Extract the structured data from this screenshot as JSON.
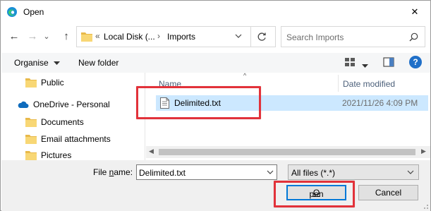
{
  "window": {
    "title": "Open",
    "close_glyph": "✕"
  },
  "nav": {
    "back_glyph": "←",
    "forward_glyph": "→",
    "recent_glyph": "⌄",
    "up_glyph": "↑"
  },
  "address": {
    "overflow": "«",
    "crumbs": [
      "Local Disk (...",
      "Imports"
    ],
    "separator": "›"
  },
  "search": {
    "placeholder": "Search Imports"
  },
  "toolbar": {
    "organise_label": "Organise",
    "new_folder_label": "New folder",
    "help_glyph": "?"
  },
  "nav_pane": {
    "items": [
      {
        "label": "Public",
        "icon": "folder-icon"
      },
      {
        "label": "OneDrive - Personal",
        "icon": "cloud-icon"
      },
      {
        "label": "Documents",
        "icon": "folder-icon"
      },
      {
        "label": "Email attachments",
        "icon": "folder-icon"
      },
      {
        "label": "Pictures",
        "icon": "folder-icon"
      }
    ]
  },
  "file_list": {
    "columns": [
      "Name",
      "Date modified"
    ],
    "sort_glyph": "^",
    "rows": [
      {
        "name": "Delimited.txt",
        "date": "2021/11/26 4:09 PM",
        "selected": true
      }
    ]
  },
  "scrollbar": {
    "left_glyph": "◀",
    "right_glyph": "▶"
  },
  "bottom": {
    "file_name_label_pre": "File ",
    "file_name_label_key": "n",
    "file_name_label_post": "ame:",
    "file_name_value": "Delimited.txt",
    "filter_value": "All files (*.*)",
    "open_label_key": "O",
    "open_label_rest": "pen",
    "cancel_label": "Cancel"
  },
  "colors": {
    "accent": "#0078d7",
    "selection": "#cce8ff",
    "highlight": "#e2323a"
  }
}
